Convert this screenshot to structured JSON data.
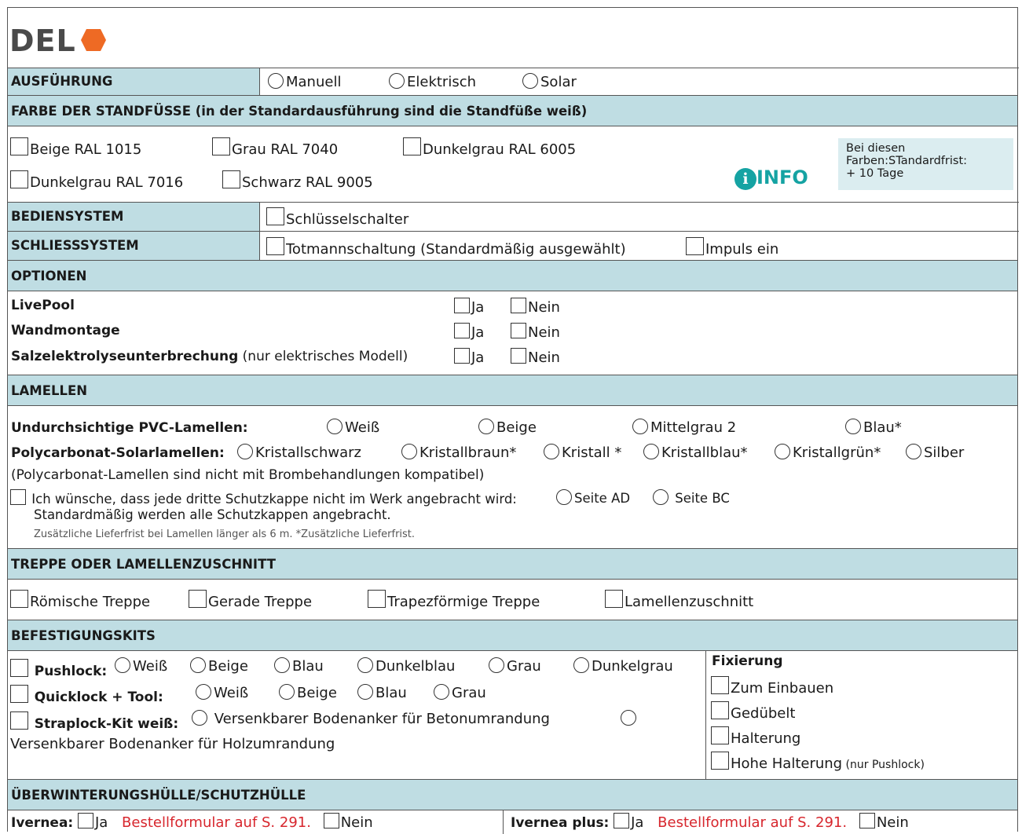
{
  "brand": {
    "name": "DEL",
    "accent": "#ee6a24"
  },
  "colors": {
    "header_bg": "#bfdde3",
    "info": "#15a3a3",
    "note_red": "#d7262d"
  },
  "ausfuehrung": {
    "title": "AUSFÜHRUNG",
    "options": [
      "Manuell",
      "Elektrisch",
      "Solar"
    ]
  },
  "farbe": {
    "title": "FARBE DER STANDFÜSSE (in der Standardausführung sind die Standfüße weiß)",
    "options": [
      "Beige RAL 1015",
      "Grau RAL 7040",
      "Dunkelgrau RAL 6005",
      "Dunkelgrau RAL 7016",
      "Schwarz RAL 9005"
    ],
    "info_word": "INFO",
    "info_icon": "i",
    "info_text": [
      "Bei diesen",
      "Farben:STandardfrist:",
      "+ 10 Tage"
    ]
  },
  "bediensystem": {
    "title": "BEDIENSYSTEM",
    "option": "Schlüsselschalter"
  },
  "schliesssystem": {
    "title": "SCHLIESSSYSTEM",
    "options": [
      "Totmannschaltung (Standardmäßig ausgewählt)",
      "Impuls ein"
    ]
  },
  "optionen": {
    "title": "OPTIONEN",
    "ja": "Ja",
    "nein": "Nein",
    "items": [
      {
        "label": "LivePool",
        "note": ""
      },
      {
        "label": "Wandmontage",
        "note": ""
      },
      {
        "label": "Salzelektrolyseunterbrechung",
        "note": " (nur elektrisches Modell)"
      }
    ]
  },
  "lamellen": {
    "title": "LAMELLEN",
    "pvc_label": "Undurchsichtige PVC-Lamellen:",
    "pvc_options": [
      "Weiß",
      "Beige",
      "Mittelgrau 2",
      "Blau*"
    ],
    "poly_label": "Polycarbonat-Solarlamellen:",
    "poly_options": [
      "Kristallschwarz",
      "Kristallbraun*",
      "Kristall *",
      "Kristallblau*",
      "Kristallgrün*",
      "Silber"
    ],
    "poly_note": "(Polycarbonat-Lamellen sind nicht mit Brombehandlungen kompatibel)",
    "kappe_text": "Ich wünsche, dass jede dritte Schutzkappe nicht im Werk angebracht wird:",
    "kappe_options": [
      "Seite AD",
      "Seite BC"
    ],
    "kappe_note": "Standardmäßig werden alle Schutzkappen angebracht.",
    "footnote": "Zusätzliche Lieferfrist bei Lamellen länger als 6 m. *Zusätzliche Lieferfrist."
  },
  "treppe": {
    "title": "TREPPE ODER LAMELLENZUSCHNITT",
    "options": [
      "Römische Treppe",
      "Gerade Treppe",
      "Trapezförmige Treppe",
      "Lamellenzuschnitt"
    ]
  },
  "befestigung": {
    "title": "BEFESTIGUNGSKITS",
    "pushlock_label": "Pushlock:",
    "pushlock_options": [
      "Weiß",
      "Beige",
      "Blau",
      "Dunkelblau",
      "Grau",
      "Dunkelgrau"
    ],
    "quicklock_label": "Quicklock + Tool:",
    "quicklock_options": [
      "Weiß",
      "Beige",
      "Blau",
      "Grau"
    ],
    "straplock_label": "Straplock-Kit weiß:",
    "straplock_option_1": "Versenkbarer Bodenanker für Betonumrandung",
    "straplock_option_2": "Versenkbarer Bodenanker für Holzumrandung",
    "fix_title": "Fixierung",
    "fix_options": [
      "Zum Einbauen",
      "Gedübelt",
      "Halterung",
      "Hohe Halterung"
    ],
    "fix_note": " (nur Pushlock)"
  },
  "huelle": {
    "title": "ÜBERWINTERUNGSHÜLLE/SCHUTZHÜLLE",
    "ivernea_label": "Ivernea:",
    "ivernea_plus_label": "Ivernea plus:",
    "ja": "Ja",
    "nein": "Nein",
    "order_note": "Bestellformular auf S. 291."
  }
}
